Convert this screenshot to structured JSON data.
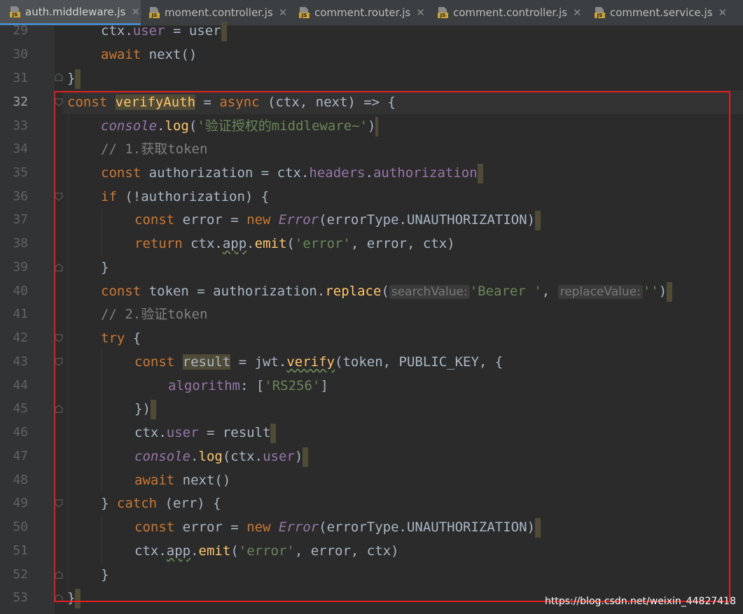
{
  "tabs": [
    {
      "label": "auth.middleware.js",
      "active": true
    },
    {
      "label": "moment.controller.js",
      "active": false
    },
    {
      "label": "comment.router.js",
      "active": false
    },
    {
      "label": "comment.controller.js",
      "active": false
    },
    {
      "label": "comment.service.js",
      "active": false
    }
  ],
  "close_glyph": "✕",
  "icon_badge": "JS",
  "line_numbers": [
    "29",
    "30",
    "31",
    "32",
    "33",
    "34",
    "35",
    "36",
    "37",
    "38",
    "39",
    "40",
    "41",
    "42",
    "43",
    "44",
    "45",
    "46",
    "47",
    "48",
    "49",
    "50",
    "51",
    "52",
    "53"
  ],
  "current_line": "32",
  "code": {
    "l29": "ctx.user = user",
    "l30": "await next()",
    "l31": "}",
    "l32": "const verifyAuth = async (ctx, next) => {",
    "l33": "console.log('验证授权的middleware~')",
    "l34": "// 1.获取token",
    "l35": "const authorization = ctx.headers.authorization",
    "l36": "if (!authorization) {",
    "l37": "const error = new Error(errorType.UNAUTHORIZATION)",
    "l38": "return ctx.app.emit('error', error, ctx)",
    "l39": "}",
    "l40": "const token = authorization.replace(searchValue: 'Bearer ', replaceValue: '')",
    "l41": "// 2.验证token",
    "l42": "try {",
    "l43": "const result = jwt.verify(token, PUBLIC_KEY, {",
    "l44": "algorithm: ['RS256']",
    "l45": "})",
    "l46": "ctx.user = result",
    "l47": "console.log(ctx.user)",
    "l48": "await next()",
    "l49": "} catch (err) {",
    "l50": "const error = new Error(errorType.UNAUTHORIZATION)",
    "l51": "ctx.app.emit('error', error, ctx)",
    "l52": "}",
    "l53": "}"
  },
  "tokens": {
    "l32": {
      "kw1": "const ",
      "name": "verifyAuth",
      "op1": " = ",
      "kw2": "async",
      "rest": " (ctx, next) => {"
    },
    "l33": {
      "obj": "console",
      "dot": ".",
      "fn": "log",
      "p1": "(",
      "str": "'验证授权的middleware~'",
      "p2": ")"
    },
    "l35": {
      "kw": "const ",
      "a": "authorization = ctx.",
      "p1": "headers",
      "dot": ".",
      "p2": "authorization"
    },
    "l36": {
      "kw": "if ",
      "rest": "(!authorization) {"
    },
    "l37": {
      "kw1": "const ",
      "a": "error = ",
      "kw2": "new ",
      "cls": "Error",
      "b": "(errorType.",
      "c": "UNAUTHORIZATION",
      ")": ")"
    },
    "l38": {
      "kw": "return ",
      "a": "ctx.",
      "app": "app",
      "dot": ".",
      "fn": "emit",
      "p": "(",
      "str": "'error'",
      "sep": ", error, ctx)"
    },
    "l40": {
      "kw": "const ",
      "a": "token = authorization.",
      "fn": "replace",
      "p": "(",
      "h1": "searchValue:",
      "s1": "'Bearer '",
      "c": ", ",
      "h2": "replaceValue:",
      "s2": "''",
      ")": ")"
    },
    "l42": {
      "kw": "try ",
      "rest": "{"
    },
    "l43": {
      "kw": "const ",
      "res": "result",
      "a": " = jwt.",
      "fn": "verify",
      "rest": "(token, PUBLIC_KEY, {"
    },
    "l44": {
      "prop": "algorithm",
      "a": ": [",
      "str": "'RS256'",
      "b": "]"
    },
    "l46": {
      "a": "ctx.",
      "prop": "user",
      "b": " = result"
    },
    "l47": {
      "obj": "console",
      "dot": ".",
      "fn": "log",
      "a": "(ctx.",
      "prop": "user",
      "b": ")"
    },
    "l48": {
      "kw": "await ",
      "rest": "next()"
    },
    "l49": {
      "a": "} ",
      "kw": "catch ",
      "b": "(err) {"
    },
    "l50": {
      "kw1": "const ",
      "a": "error = ",
      "kw2": "new ",
      "cls": "Error",
      "b": "(errorType.",
      "c": "UNAUTHORIZATION",
      ")": ")"
    },
    "l51": {
      "a": "ctx.",
      "app": "app",
      "dot": ".",
      "fn": "emit",
      "p": "(",
      "str": "'error'",
      "sep": ", error, ctx)"
    },
    "l29": {
      "a": "ctx.",
      "prop": "user",
      "b": " = user"
    },
    "l30": {
      "kw": "await ",
      "rest": "next()"
    }
  },
  "watermark": "https://blog.csdn.net/weixin_44827418",
  "colors": {
    "background": "#2b2b2b",
    "gutter": "#313335",
    "keyword": "#cc7832",
    "string": "#6a8759",
    "property": "#9876aa",
    "function": "#ffc66d",
    "comment": "#808080",
    "highlight_box": "#e02020"
  }
}
